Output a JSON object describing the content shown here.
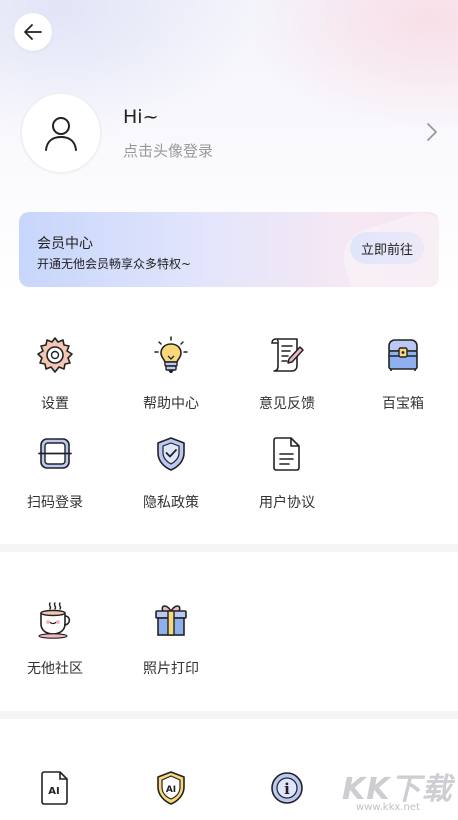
{
  "profile": {
    "greeting": "Hi~",
    "login_hint": "点击头像登录"
  },
  "vip": {
    "title": "会员中心",
    "subtitle": "开通无他会员畅享众多特权~",
    "button": "立即前往"
  },
  "tools": [
    {
      "label": "设置",
      "icon": "gear-icon"
    },
    {
      "label": "帮助中心",
      "icon": "lightbulb-icon"
    },
    {
      "label": "意见反馈",
      "icon": "scroll-pen-icon"
    },
    {
      "label": "百宝箱",
      "icon": "treasure-chest-icon"
    },
    {
      "label": "扫码登录",
      "icon": "scan-icon"
    },
    {
      "label": "隐私政策",
      "icon": "shield-check-icon"
    },
    {
      "label": "用户协议",
      "icon": "document-icon"
    }
  ],
  "community": [
    {
      "label": "无他社区",
      "icon": "coffee-cup-icon"
    },
    {
      "label": "照片打印",
      "icon": "gift-box-icon"
    }
  ],
  "bottom_icons": [
    {
      "icon": "ai-file-icon",
      "text": "AI"
    },
    {
      "icon": "ai-shield-icon",
      "text": "AI"
    },
    {
      "icon": "info-icon",
      "text": "i"
    }
  ],
  "watermark": {
    "logo": "KK下载",
    "url": "www.kkx.net"
  },
  "colors": {
    "icon_stroke": "#222222",
    "icon_accent_yellow": "#f8d879",
    "icon_accent_blue": "#b9c9f3",
    "icon_accent_pink": "#f3b8c4"
  }
}
